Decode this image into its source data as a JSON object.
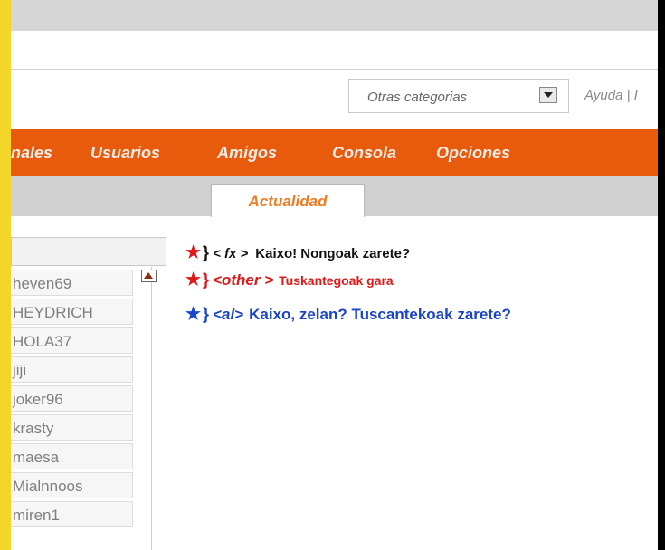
{
  "header": {
    "category_select": {
      "value": "Otras categorias"
    },
    "help_link": "Ayuda | I"
  },
  "nav": {
    "items": [
      "nales",
      "Usuarios",
      "Amigos",
      "Consola",
      "Opciones"
    ]
  },
  "tabs": {
    "active_label": "Actualidad"
  },
  "users": [
    "heven69",
    "HEYDRICH",
    "HOLA37",
    "jiji",
    "joker96",
    "krasty",
    "maesa",
    "Mialnnoos",
    "miren1"
  ],
  "messages": [
    {
      "star": "★",
      "brace": "}",
      "nick": "< fx >",
      "text": "Kaixo! Nongoak zarete?"
    },
    {
      "star": "★",
      "brace": "}",
      "nick": "<other >",
      "text": "Tuskantegoak gara"
    },
    {
      "star": "★",
      "brace": "}",
      "nick": "<al>",
      "text": "Kaixo, zelan? Tuscantekoak zarete?"
    }
  ],
  "colors": {
    "nav_bg": "#e85a0c",
    "tab_text": "#f07a22",
    "msg_red": "#e01818",
    "msg_blue": "#1a45c8",
    "edge_yellow": "#f3d628"
  }
}
